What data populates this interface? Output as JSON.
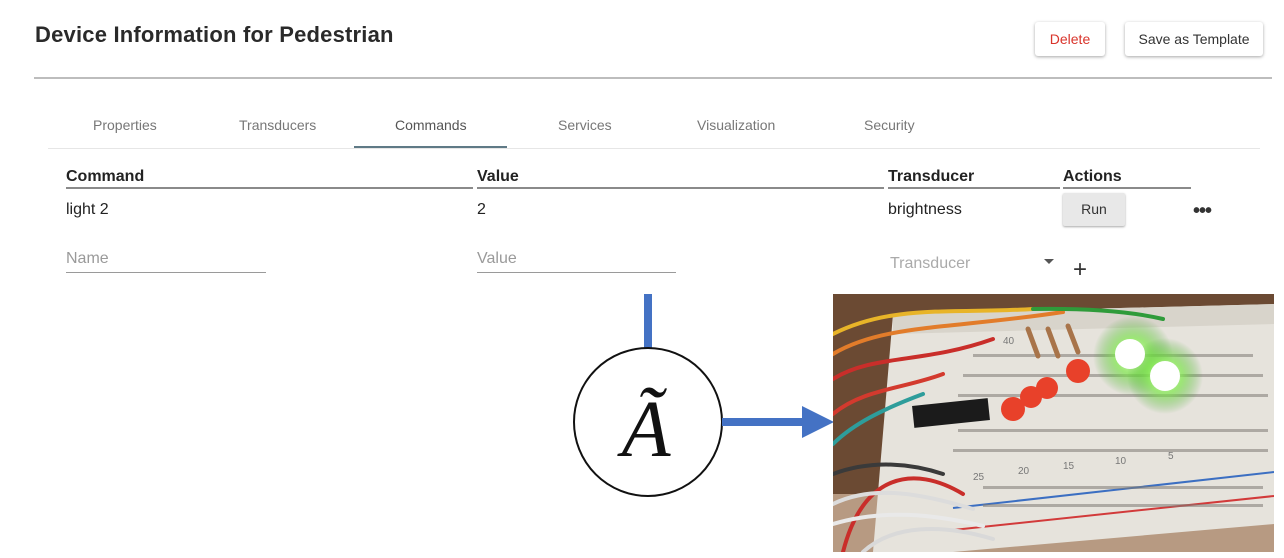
{
  "header": {
    "title": "Device Information for Pedestrian",
    "delete_label": "Delete",
    "save_template_label": "Save as Template"
  },
  "tabs": [
    {
      "label": "Properties",
      "active": false
    },
    {
      "label": "Transducers",
      "active": false
    },
    {
      "label": "Commands",
      "active": true
    },
    {
      "label": "Services",
      "active": false
    },
    {
      "label": "Visualization",
      "active": false
    },
    {
      "label": "Security",
      "active": false
    }
  ],
  "table": {
    "columns": [
      "Command",
      "Value",
      "Transducer",
      "Actions"
    ],
    "rows": [
      {
        "command": "light 2",
        "value": "2",
        "transducer": "brightness",
        "action_label": "Run"
      }
    ]
  },
  "new_row": {
    "name_placeholder": "Name",
    "value_placeholder": "Value",
    "transducer_placeholder": "Transducer"
  },
  "diagram": {
    "symbol": "Ã"
  },
  "photo": {
    "board_numbers": [
      "40",
      "25",
      "20",
      "15",
      "10",
      "5"
    ]
  },
  "colors": {
    "delete": "#d9342b",
    "tab_indicator": "#5f7a86",
    "arrow": "#4472c4",
    "led_red": "#e8412a",
    "led_green": "#7de84a"
  },
  "icons": [
    "more-horizontal-icon",
    "dropdown-caret-icon",
    "plus-icon",
    "arrow-right-icon"
  ]
}
